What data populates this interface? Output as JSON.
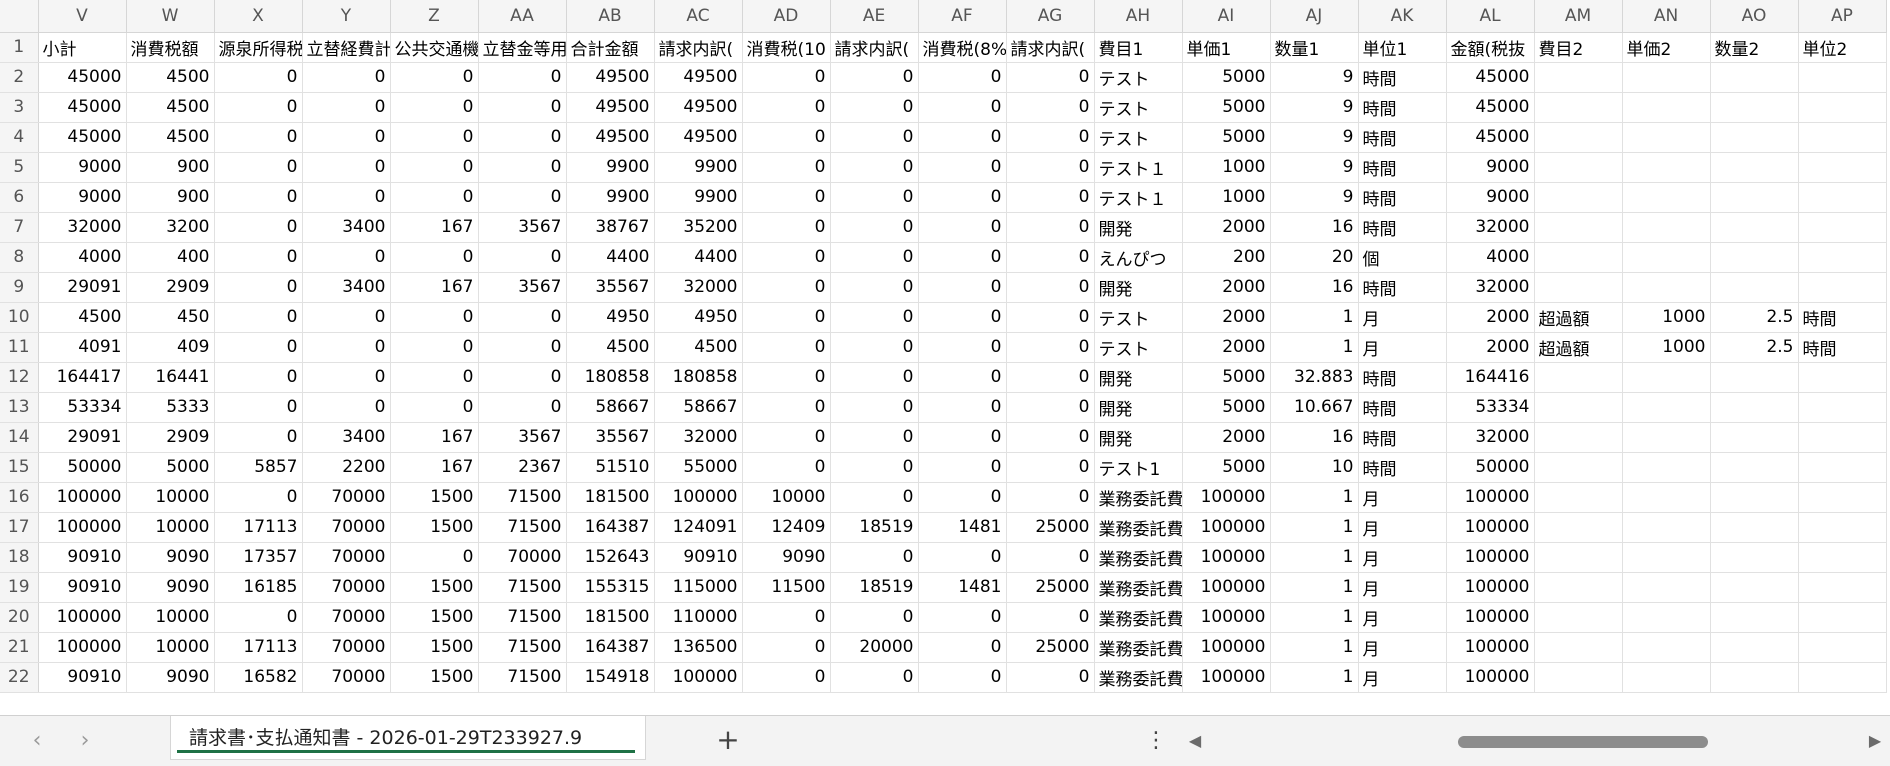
{
  "columns": [
    "V",
    "W",
    "X",
    "Y",
    "Z",
    "AA",
    "AB",
    "AC",
    "AD",
    "AE",
    "AF",
    "AG",
    "AH",
    "AI",
    "AJ",
    "AK",
    "AL",
    "AM",
    "AN",
    "AO",
    "AP"
  ],
  "rows": [
    {
      "n": "1",
      "c": [
        "小計",
        "消費税額",
        "源泉所得税",
        "立替経費計",
        "公共交通機",
        "立替金等用",
        "合計金額",
        "請求内訳(",
        "消費税(10",
        "請求内訳(",
        "消費税(8%",
        "請求内訳(",
        "費目1",
        "単価1",
        "数量1",
        "単位1",
        "金額(税抜",
        "費目2",
        "単価2",
        "数量2",
        "単位2"
      ]
    },
    {
      "n": "2",
      "c": [
        "45000",
        "4500",
        "0",
        "0",
        "0",
        "0",
        "49500",
        "49500",
        "0",
        "0",
        "0",
        "0",
        "テスト",
        "5000",
        "9",
        "時間",
        "45000",
        "",
        "",
        "",
        ""
      ]
    },
    {
      "n": "3",
      "c": [
        "45000",
        "4500",
        "0",
        "0",
        "0",
        "0",
        "49500",
        "49500",
        "0",
        "0",
        "0",
        "0",
        "テスト",
        "5000",
        "9",
        "時間",
        "45000",
        "",
        "",
        "",
        ""
      ]
    },
    {
      "n": "4",
      "c": [
        "45000",
        "4500",
        "0",
        "0",
        "0",
        "0",
        "49500",
        "49500",
        "0",
        "0",
        "0",
        "0",
        "テスト",
        "5000",
        "9",
        "時間",
        "45000",
        "",
        "",
        "",
        ""
      ]
    },
    {
      "n": "5",
      "c": [
        "9000",
        "900",
        "0",
        "0",
        "0",
        "0",
        "9900",
        "9900",
        "0",
        "0",
        "0",
        "0",
        "テスト１",
        "1000",
        "9",
        "時間",
        "9000",
        "",
        "",
        "",
        ""
      ]
    },
    {
      "n": "6",
      "c": [
        "9000",
        "900",
        "0",
        "0",
        "0",
        "0",
        "9900",
        "9900",
        "0",
        "0",
        "0",
        "0",
        "テスト１",
        "1000",
        "9",
        "時間",
        "9000",
        "",
        "",
        "",
        ""
      ]
    },
    {
      "n": "7",
      "c": [
        "32000",
        "3200",
        "0",
        "3400",
        "167",
        "3567",
        "38767",
        "35200",
        "0",
        "0",
        "0",
        "0",
        "開発",
        "2000",
        "16",
        "時間",
        "32000",
        "",
        "",
        "",
        ""
      ]
    },
    {
      "n": "8",
      "c": [
        "4000",
        "400",
        "0",
        "0",
        "0",
        "0",
        "4400",
        "4400",
        "0",
        "0",
        "0",
        "0",
        "えんぴつ",
        "200",
        "20",
        "個",
        "4000",
        "",
        "",
        "",
        ""
      ]
    },
    {
      "n": "9",
      "c": [
        "29091",
        "2909",
        "0",
        "3400",
        "167",
        "3567",
        "35567",
        "32000",
        "0",
        "0",
        "0",
        "0",
        "開発",
        "2000",
        "16",
        "時間",
        "32000",
        "",
        "",
        "",
        ""
      ]
    },
    {
      "n": "10",
      "c": [
        "4500",
        "450",
        "0",
        "0",
        "0",
        "0",
        "4950",
        "4950",
        "0",
        "0",
        "0",
        "0",
        "テスト",
        "2000",
        "1",
        "月",
        "2000",
        "超過額",
        "1000",
        "2.5",
        "時間"
      ]
    },
    {
      "n": "11",
      "c": [
        "4091",
        "409",
        "0",
        "0",
        "0",
        "0",
        "4500",
        "4500",
        "0",
        "0",
        "0",
        "0",
        "テスト",
        "2000",
        "1",
        "月",
        "2000",
        "超過額",
        "1000",
        "2.5",
        "時間"
      ]
    },
    {
      "n": "12",
      "c": [
        "164417",
        "16441",
        "0",
        "0",
        "0",
        "0",
        "180858",
        "180858",
        "0",
        "0",
        "0",
        "0",
        "開発",
        "5000",
        "32.883",
        "時間",
        "164416",
        "",
        "",
        "",
        ""
      ]
    },
    {
      "n": "13",
      "c": [
        "53334",
        "5333",
        "0",
        "0",
        "0",
        "0",
        "58667",
        "58667",
        "0",
        "0",
        "0",
        "0",
        "開発",
        "5000",
        "10.667",
        "時間",
        "53334",
        "",
        "",
        "",
        ""
      ]
    },
    {
      "n": "14",
      "c": [
        "29091",
        "2909",
        "0",
        "3400",
        "167",
        "3567",
        "35567",
        "32000",
        "0",
        "0",
        "0",
        "0",
        "開発",
        "2000",
        "16",
        "時間",
        "32000",
        "",
        "",
        "",
        ""
      ]
    },
    {
      "n": "15",
      "c": [
        "50000",
        "5000",
        "5857",
        "2200",
        "167",
        "2367",
        "51510",
        "55000",
        "0",
        "0",
        "0",
        "0",
        "テスト1",
        "5000",
        "10",
        "時間",
        "50000",
        "",
        "",
        "",
        ""
      ]
    },
    {
      "n": "16",
      "c": [
        "100000",
        "10000",
        "0",
        "70000",
        "1500",
        "71500",
        "181500",
        "100000",
        "10000",
        "0",
        "0",
        "0",
        "業務委託費",
        "100000",
        "1",
        "月",
        "100000",
        "",
        "",
        "",
        ""
      ]
    },
    {
      "n": "17",
      "c": [
        "100000",
        "10000",
        "17113",
        "70000",
        "1500",
        "71500",
        "164387",
        "124091",
        "12409",
        "18519",
        "1481",
        "25000",
        "業務委託費",
        "100000",
        "1",
        "月",
        "100000",
        "",
        "",
        "",
        ""
      ]
    },
    {
      "n": "18",
      "c": [
        "90910",
        "9090",
        "17357",
        "70000",
        "0",
        "70000",
        "152643",
        "90910",
        "9090",
        "0",
        "0",
        "0",
        "業務委託費",
        "100000",
        "1",
        "月",
        "100000",
        "",
        "",
        "",
        ""
      ]
    },
    {
      "n": "19",
      "c": [
        "90910",
        "9090",
        "16185",
        "70000",
        "1500",
        "71500",
        "155315",
        "115000",
        "11500",
        "18519",
        "1481",
        "25000",
        "業務委託費",
        "100000",
        "1",
        "月",
        "100000",
        "",
        "",
        "",
        ""
      ]
    },
    {
      "n": "20",
      "c": [
        "100000",
        "10000",
        "0",
        "70000",
        "1500",
        "71500",
        "181500",
        "110000",
        "0",
        "0",
        "0",
        "0",
        "業務委託費",
        "100000",
        "1",
        "月",
        "100000",
        "",
        "",
        "",
        ""
      ]
    },
    {
      "n": "21",
      "c": [
        "100000",
        "10000",
        "17113",
        "70000",
        "1500",
        "71500",
        "164387",
        "136500",
        "0",
        "20000",
        "0",
        "25000",
        "業務委託費",
        "100000",
        "1",
        "月",
        "100000",
        "",
        "",
        "",
        ""
      ]
    },
    {
      "n": "22",
      "c": [
        "90910",
        "9090",
        "16582",
        "70000",
        "1500",
        "71500",
        "154918",
        "100000",
        "0",
        "0",
        "0",
        "0",
        "業務委託費",
        "100000",
        "1",
        "月",
        "100000",
        "",
        "",
        "",
        ""
      ]
    }
  ],
  "sheet_tab": {
    "label": "請求書･支払通知書 - 2026-01-29T233927.9"
  },
  "tabbar": {
    "prev": "‹",
    "next": "›",
    "add": "+",
    "more": "⋮",
    "scroll_left": "◀",
    "scroll_right": "▶"
  }
}
